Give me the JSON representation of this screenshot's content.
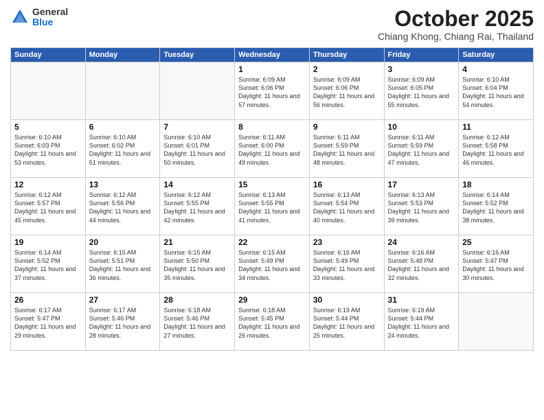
{
  "header": {
    "logo_general": "General",
    "logo_blue": "Blue",
    "month_title": "October 2025",
    "subtitle": "Chiang Khong, Chiang Rai, Thailand"
  },
  "days_of_week": [
    "Sunday",
    "Monday",
    "Tuesday",
    "Wednesday",
    "Thursday",
    "Friday",
    "Saturday"
  ],
  "weeks": [
    [
      {
        "day": "",
        "info": ""
      },
      {
        "day": "",
        "info": ""
      },
      {
        "day": "",
        "info": ""
      },
      {
        "day": "1",
        "info": "Sunrise: 6:09 AM\nSunset: 6:06 PM\nDaylight: 11 hours and 57 minutes."
      },
      {
        "day": "2",
        "info": "Sunrise: 6:09 AM\nSunset: 6:06 PM\nDaylight: 11 hours and 56 minutes."
      },
      {
        "day": "3",
        "info": "Sunrise: 6:09 AM\nSunset: 6:05 PM\nDaylight: 11 hours and 55 minutes."
      },
      {
        "day": "4",
        "info": "Sunrise: 6:10 AM\nSunset: 6:04 PM\nDaylight: 11 hours and 54 minutes."
      }
    ],
    [
      {
        "day": "5",
        "info": "Sunrise: 6:10 AM\nSunset: 6:03 PM\nDaylight: 11 hours and 53 minutes."
      },
      {
        "day": "6",
        "info": "Sunrise: 6:10 AM\nSunset: 6:02 PM\nDaylight: 11 hours and 51 minutes."
      },
      {
        "day": "7",
        "info": "Sunrise: 6:10 AM\nSunset: 6:01 PM\nDaylight: 11 hours and 50 minutes."
      },
      {
        "day": "8",
        "info": "Sunrise: 6:11 AM\nSunset: 6:00 PM\nDaylight: 11 hours and 49 minutes."
      },
      {
        "day": "9",
        "info": "Sunrise: 6:11 AM\nSunset: 5:59 PM\nDaylight: 11 hours and 48 minutes."
      },
      {
        "day": "10",
        "info": "Sunrise: 6:11 AM\nSunset: 5:59 PM\nDaylight: 11 hours and 47 minutes."
      },
      {
        "day": "11",
        "info": "Sunrise: 6:12 AM\nSunset: 5:58 PM\nDaylight: 11 hours and 46 minutes."
      }
    ],
    [
      {
        "day": "12",
        "info": "Sunrise: 6:12 AM\nSunset: 5:57 PM\nDaylight: 11 hours and 45 minutes."
      },
      {
        "day": "13",
        "info": "Sunrise: 6:12 AM\nSunset: 5:56 PM\nDaylight: 11 hours and 44 minutes."
      },
      {
        "day": "14",
        "info": "Sunrise: 6:12 AM\nSunset: 5:55 PM\nDaylight: 11 hours and 42 minutes."
      },
      {
        "day": "15",
        "info": "Sunrise: 6:13 AM\nSunset: 5:55 PM\nDaylight: 11 hours and 41 minutes."
      },
      {
        "day": "16",
        "info": "Sunrise: 6:13 AM\nSunset: 5:54 PM\nDaylight: 11 hours and 40 minutes."
      },
      {
        "day": "17",
        "info": "Sunrise: 6:13 AM\nSunset: 5:53 PM\nDaylight: 11 hours and 39 minutes."
      },
      {
        "day": "18",
        "info": "Sunrise: 6:14 AM\nSunset: 5:52 PM\nDaylight: 11 hours and 38 minutes."
      }
    ],
    [
      {
        "day": "19",
        "info": "Sunrise: 6:14 AM\nSunset: 5:52 PM\nDaylight: 11 hours and 37 minutes."
      },
      {
        "day": "20",
        "info": "Sunrise: 6:15 AM\nSunset: 5:51 PM\nDaylight: 11 hours and 36 minutes."
      },
      {
        "day": "21",
        "info": "Sunrise: 6:15 AM\nSunset: 5:50 PM\nDaylight: 11 hours and 35 minutes."
      },
      {
        "day": "22",
        "info": "Sunrise: 6:15 AM\nSunset: 5:49 PM\nDaylight: 11 hours and 34 minutes."
      },
      {
        "day": "23",
        "info": "Sunrise: 6:16 AM\nSunset: 5:49 PM\nDaylight: 11 hours and 33 minutes."
      },
      {
        "day": "24",
        "info": "Sunrise: 6:16 AM\nSunset: 5:48 PM\nDaylight: 11 hours and 32 minutes."
      },
      {
        "day": "25",
        "info": "Sunrise: 6:16 AM\nSunset: 5:47 PM\nDaylight: 11 hours and 30 minutes."
      }
    ],
    [
      {
        "day": "26",
        "info": "Sunrise: 6:17 AM\nSunset: 5:47 PM\nDaylight: 11 hours and 29 minutes."
      },
      {
        "day": "27",
        "info": "Sunrise: 6:17 AM\nSunset: 5:46 PM\nDaylight: 11 hours and 28 minutes."
      },
      {
        "day": "28",
        "info": "Sunrise: 6:18 AM\nSunset: 5:46 PM\nDaylight: 11 hours and 27 minutes."
      },
      {
        "day": "29",
        "info": "Sunrise: 6:18 AM\nSunset: 5:45 PM\nDaylight: 11 hours and 26 minutes."
      },
      {
        "day": "30",
        "info": "Sunrise: 6:19 AM\nSunset: 5:44 PM\nDaylight: 11 hours and 25 minutes."
      },
      {
        "day": "31",
        "info": "Sunrise: 6:19 AM\nSunset: 5:44 PM\nDaylight: 11 hours and 24 minutes."
      },
      {
        "day": "",
        "info": ""
      }
    ]
  ]
}
